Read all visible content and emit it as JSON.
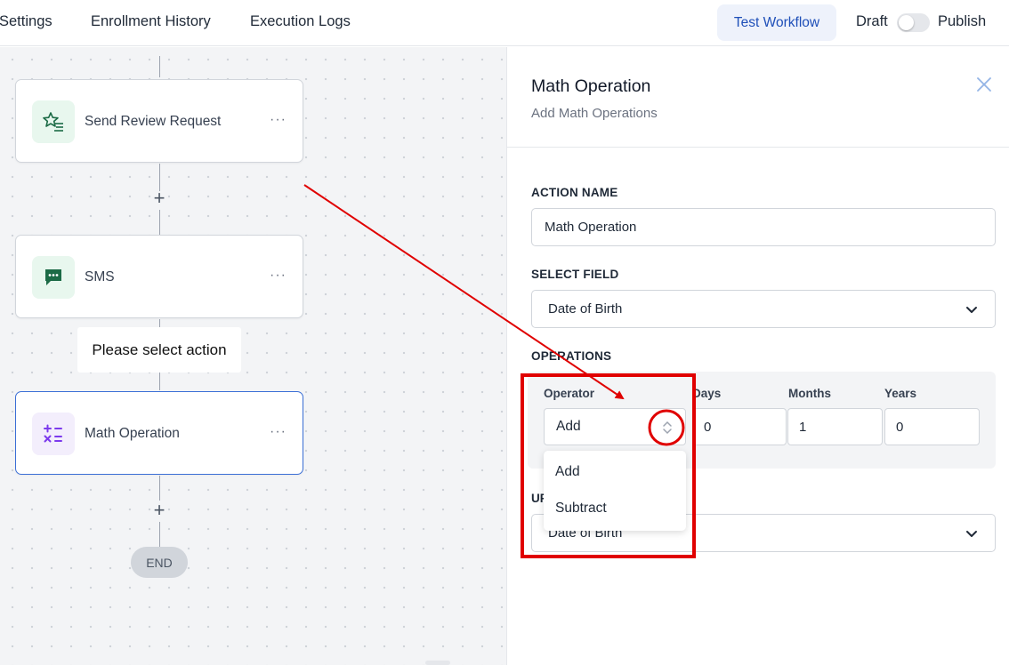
{
  "topnav": {
    "tabs": [
      "Settings",
      "Enrollment History",
      "Execution Logs"
    ],
    "test_button": "Test Workflow",
    "draft_label": "Draft",
    "publish_label": "Publish"
  },
  "canvas": {
    "nodes": [
      {
        "label": "Send Review Request",
        "icon": "star-list-icon"
      },
      {
        "label": "SMS",
        "icon": "chat-bubble-icon"
      },
      {
        "label": "Math Operation",
        "icon": "math-operators-icon"
      }
    ],
    "node_menu": "···",
    "plus": "+",
    "tooltip": "Please select action",
    "end": "END"
  },
  "panel": {
    "title": "Math Operation",
    "subtitle": "Add Math Operations",
    "action_name_label": "ACTION NAME",
    "action_name_value": "Math Operation",
    "select_field_label": "SELECT FIELD",
    "select_field_value": "Date of Birth",
    "operations_label": "OPERATIONS",
    "columns": {
      "operator": "Operator",
      "days": "Days",
      "months": "Months",
      "years": "Years"
    },
    "operator_value": "Add",
    "days_value": "0",
    "months_value": "1",
    "years_value": "0",
    "operator_options": [
      "Add",
      "Subtract"
    ],
    "update_label_fragment": "UP",
    "update_field_value": "Date of Birth"
  },
  "colors": {
    "accent": "#1e4fb8",
    "annotation_red": "#e00000",
    "selected_border": "#3b6fd6"
  }
}
